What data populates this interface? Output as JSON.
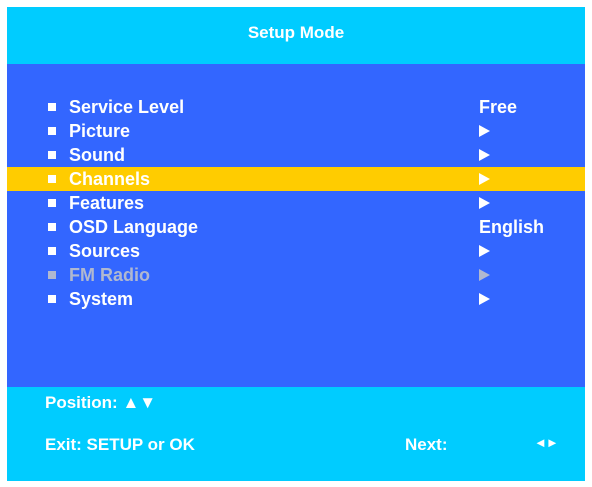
{
  "header": {
    "title": "Setup Mode"
  },
  "menu": {
    "items": [
      {
        "label": "Service Level",
        "value": "Free"
      },
      {
        "label": "Picture",
        "value": "►"
      },
      {
        "label": "Sound",
        "value": "►"
      },
      {
        "label": "Channels",
        "value": "►",
        "selected": true
      },
      {
        "label": "Features",
        "value": "►"
      },
      {
        "label": "OSD Language",
        "value": "English"
      },
      {
        "label": "Sources",
        "value": "►"
      },
      {
        "label": "FM Radio",
        "value": "►",
        "disabled": true
      },
      {
        "label": "System",
        "value": "►"
      }
    ]
  },
  "footer": {
    "position": "Position: ▲▼",
    "exit": "Exit: SETUP or OK",
    "next_label": "Next:",
    "next_arrows": "◄►"
  },
  "colors": {
    "header_bg": "#00ccff",
    "menu_bg": "#3366ff",
    "highlight": "#ffcc00",
    "text": "#ffffff",
    "disabled_text": "#b0b8d0"
  },
  "icons": {
    "bullet": "square-bullet-icon",
    "submenu": "right-arrow-icon"
  }
}
